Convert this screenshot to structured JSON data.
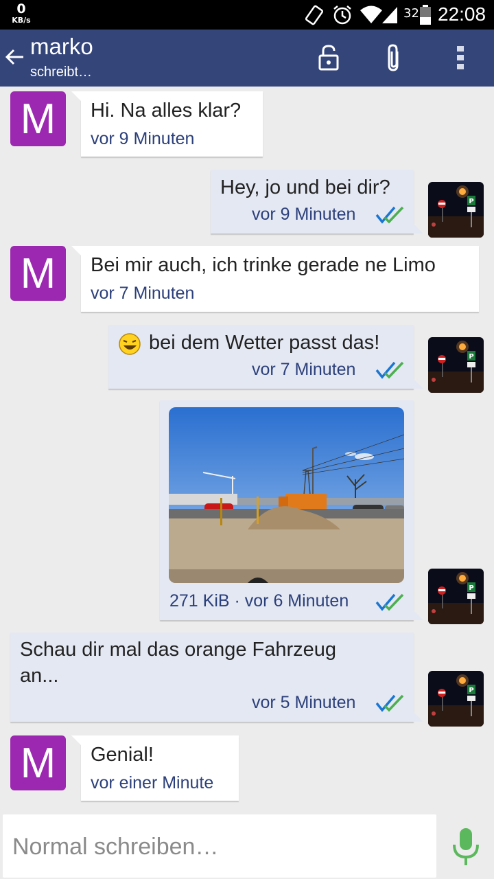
{
  "status_bar": {
    "speed_value": "0",
    "speed_unit": "KB/s",
    "battery": "32",
    "time": "22:08"
  },
  "header": {
    "contact_name": "marko",
    "status": "schreibt…",
    "icons": [
      "back-arrow-icon",
      "lock-icon",
      "paperclip-icon",
      "overflow-menu-icon"
    ],
    "bar_color": "#34457a"
  },
  "messages": [
    {
      "direction": "in",
      "avatar_letter": "M",
      "text": "Hi. Na alles klar?",
      "time": "vor 9 Minuten"
    },
    {
      "direction": "out",
      "text": "Hey, jo und bei dir?",
      "time": "vor 9 Minuten",
      "read": true
    },
    {
      "direction": "in",
      "avatar_letter": "M",
      "text": "Bei mir auch, ich trinke gerade ne Limo",
      "time": "vor 7 Minuten"
    },
    {
      "direction": "out",
      "emoji": "laughing-smiley",
      "text": "bei dem Wetter passt das!",
      "time": "vor 7 Minuten",
      "read": true
    },
    {
      "direction": "out",
      "type": "image",
      "meta": "271 KiB · vor 6 Minuten",
      "read": true
    },
    {
      "direction": "out",
      "text_line1": "Schau dir mal das orange Fahrzeug",
      "text_line2": "an...",
      "time": "vor 5 Minuten",
      "read": true
    },
    {
      "direction": "in",
      "avatar_letter": "M",
      "text": "Genial!",
      "time": "vor einer Minute"
    }
  ],
  "composer": {
    "placeholder": "Normal schreiben…",
    "mic_color": "#5cb85c"
  },
  "colors": {
    "avatar_bg": "#9c27b0",
    "outgoing_bubble": "#e4e8f3",
    "incoming_bubble": "#ffffff",
    "time_text": "#2b3f7a"
  }
}
